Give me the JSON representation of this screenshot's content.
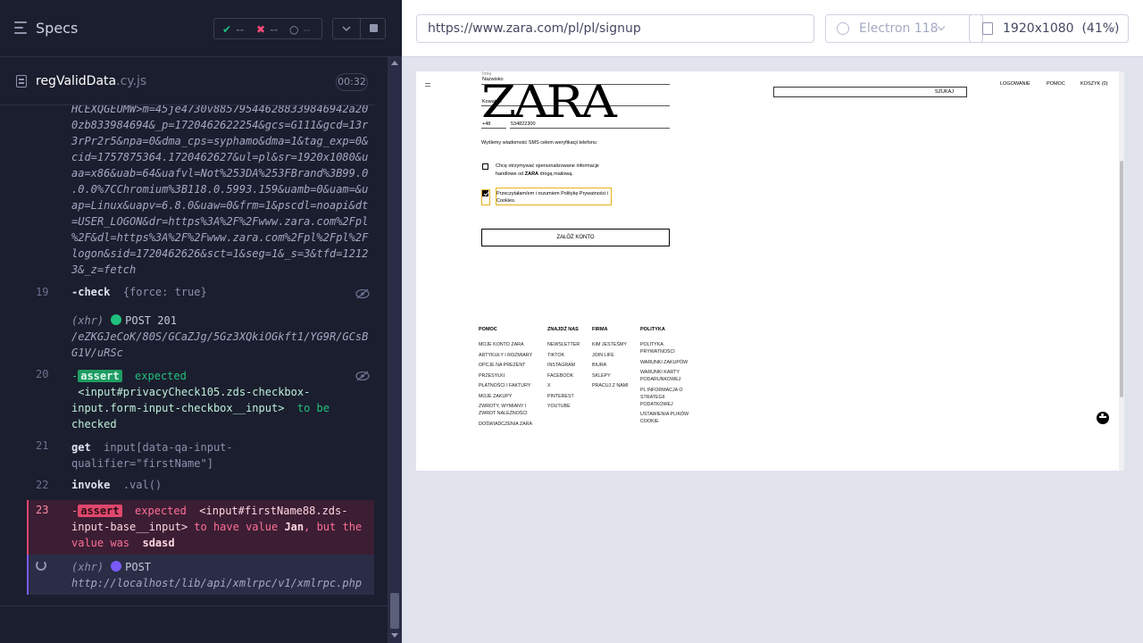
{
  "reporter": {
    "title": "Specs",
    "stats": {
      "passed": "--",
      "failed": "--",
      "pending": "--"
    },
    "spec": {
      "name": "regValidData",
      "ext": ".cy.js",
      "duration": "00:32"
    },
    "log": {
      "url_lines": [
        "HCEXQGEUMW>m=45je4730v885795446288339846942a20",
        "0zb833984694&_p=1720462622254&gcs=G111&gcd=13r",
        "3rPr2r5&npa=0&dma_cps=syphamo&dma=1&tag_exp=0&",
        "cid=1757875364.1720462627&ul=pl&sr=1920x1080&u",
        "aa=x86&uab=64&uafvl=Not%253DA%253FBrand%3B99.0",
        ".0.0%7CChromium%3B118.0.5993.159&uamb=0&uam=&u",
        "ap=Linux&uapv=6.8.0&uaw=0&frm=1&pscdl=noapi&dt",
        "=USER_LOGON&dr=https%3A%2F%2Fwww.zara.com%2Fpl",
        "%2F&dl=https%3A%2F%2Fwww.zara.com%2Fpl%2Fpl%2F",
        "logon&sid=1720462626&sct=1&seg=1&_s=3&tfd=1212",
        "3&_z=fetch"
      ],
      "row19": {
        "num": "19",
        "cmd": "-check",
        "arg": "{force: true}"
      },
      "xhr1": {
        "label": "(xhr)",
        "status": "POST 201",
        "path1": "/eZKGJeCoK/80S/GCaZJg/5Gz3XQkiOGkft1/YG9R/GCsB",
        "path2": "G1V/uRSc"
      },
      "row20": {
        "num": "20",
        "dash": "-",
        "badge": "assert",
        "expected": "expected",
        "sel1": "<input#privacyCheck105.zds-checkbox-",
        "sel2": "input.form-input-checkbox__input>",
        "to_be": "to be",
        "checked": "checked"
      },
      "row21": {
        "num": "21",
        "cmd": "get",
        "arg1": "input[data-qa-input-",
        "arg2": "qualifier=\"firstName\"]"
      },
      "row22": {
        "num": "22",
        "cmd": "invoke",
        "arg": ".val()"
      },
      "row23": {
        "num": "23",
        "dash": "-",
        "badge": "assert",
        "expected": "expected",
        "sel1": "<input#firstName88.zds-",
        "sel2": "input-base__input>",
        "to_have": "to have value",
        "value": "Jan",
        "but": ", but the",
        "value_was": "value was",
        "actual": "sdasd"
      },
      "xhr2": {
        "label": "(xhr)",
        "status": "POST",
        "url": "http://localhost/lib/api/xmlrpc/v1/xmlrpc.php"
      }
    }
  },
  "aut": {
    "url": "https://www.zara.com/pl/pl/signup",
    "browser": "Electron 118",
    "viewport": "1920x1080",
    "scale": "(41%)"
  },
  "zara": {
    "logo": "ZARA",
    "field_label_top": "Imię",
    "field_value_top": "Nazwisko",
    "field_value_2": "Kowalski",
    "phone_prefix": "+48",
    "phone_number": "534822300",
    "sms_note": "Wyślemy wiadomość SMS celem weryfikacji telefonu",
    "optin_text_1": "Chcę otrzymywać spersonalizowane informacje",
    "optin_text_2a": "handlowe od",
    "optin_brand": "ZARA",
    "optin_text_2b": "drogą mailową.",
    "privacy_text_1": "Przeczytałam/em i rozumiem Politykę Prywatności i",
    "privacy_text_2": "Cookies.",
    "create_button": "ZAŁÓŻ KONTO",
    "search": "SZUKAJ",
    "nav": {
      "login": "LOGOWANIE",
      "help": "POMOC",
      "cart": "KOSZYK (0)"
    },
    "footer": {
      "columns": [
        {
          "head": "POMOC",
          "items": [
            "MOJE KONTO ZARA",
            "ARTYKUŁY I ROZMIARY",
            "OPCJE NA PREZENT",
            "PRZESYŁKI",
            "PŁATNOŚCI I FAKTURY",
            "MOJE ZAKUPY",
            "ZWROTY, WYMIANY I",
            "ZWROT NALEŻNOŚCI",
            "DOŚWIADCZENIA ZARA"
          ]
        },
        {
          "head": "ZNAJDŹ NAS",
          "items": [
            "NEWSLETTER",
            "TIKTOK",
            "INSTAGRAM",
            "FACEBOOK",
            "X",
            "PINTEREST",
            "YOUTUBE"
          ]
        },
        {
          "head": "FIRMA",
          "items": [
            "KIM JESTEŚMY",
            "JOIN LIFE",
            "BIURA",
            "SKLEPY",
            "PRACUJ Z NAMI"
          ]
        },
        {
          "head": "POLITYKA",
          "items": [
            "POLITYKA",
            "PRYWATNOŚCI",
            "WARUNKI ZAKUPÓW",
            "WARUNKI KARTY",
            "PODARUNKOWEJ",
            "PL INFORMACJA O",
            "STRATEGII",
            "PODATKOWEJ",
            "USTAWIENIA PLIKÓW",
            "COOKIE"
          ]
        }
      ]
    }
  }
}
